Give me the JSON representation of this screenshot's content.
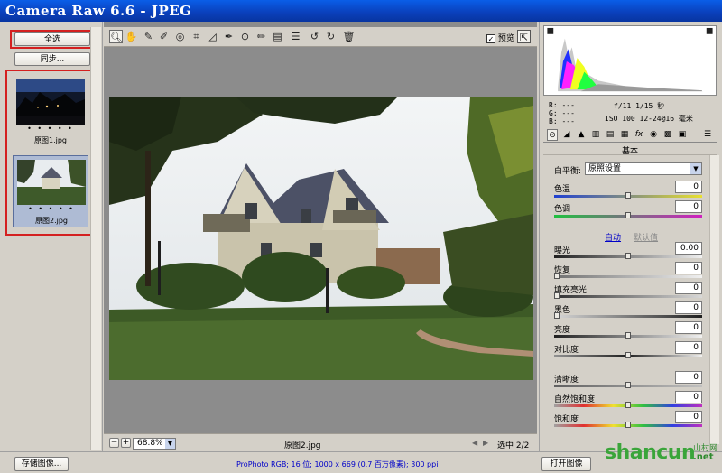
{
  "window": {
    "title": "Camera Raw 6.6 -  JPEG"
  },
  "left": {
    "select_all": "全选",
    "sync": "同步...",
    "thumbnails": [
      {
        "dots": "• • • • •",
        "filename": "原图1.jpg",
        "selected": false
      },
      {
        "dots": "• • • • •",
        "filename": "原图2.jpg",
        "selected": true
      }
    ]
  },
  "toolbar": {
    "tools": [
      "zoom-icon",
      "hand-icon",
      "white-balance-icon",
      "color-sampler-icon",
      "target-adjust-icon",
      "crop-icon",
      "straighten-icon",
      "spot-removal-icon",
      "red-eye-icon",
      "adjustment-brush-icon",
      "graduated-filter-icon",
      "preferences-icon",
      "rotate-left-icon",
      "rotate-right-icon",
      "trash-icon"
    ],
    "preview_label": "预览",
    "preview_checked": "✓"
  },
  "status": {
    "zoom": "68.8%",
    "filename": "原图2.jpg",
    "selection": "选中 2/2"
  },
  "histogram": {
    "r": "R:  ---",
    "g": "G:  ---",
    "b": "B:  ---",
    "aperture_shutter": "f/11   1/15 秒",
    "iso_lens": "ISO 100   12-24@16 毫米"
  },
  "panel": {
    "title": "基本",
    "white_balance_label": "白平衡:",
    "white_balance_value": "原照设置",
    "auto": "自动",
    "default": "默认值",
    "sliders": [
      {
        "label": "色温",
        "value": "0",
        "pos": 50
      },
      {
        "label": "色调",
        "value": "0",
        "pos": 50
      },
      {
        "label": "曝光",
        "value": "0.00",
        "pos": 50
      },
      {
        "label": "恢复",
        "value": "0",
        "pos": 0
      },
      {
        "label": "填充亮光",
        "value": "0",
        "pos": 0
      },
      {
        "label": "黑色",
        "value": "0",
        "pos": 0
      },
      {
        "label": "亮度",
        "value": "0",
        "pos": 50
      },
      {
        "label": "对比度",
        "value": "0",
        "pos": 50
      },
      {
        "label": "清晰度",
        "value": "0",
        "pos": 50
      },
      {
        "label": "自然饱和度",
        "value": "0",
        "pos": 50
      },
      {
        "label": "饱和度",
        "value": "0",
        "pos": 50
      }
    ]
  },
  "bottom": {
    "save": "存储图像...",
    "workflow": "ProPhoto RGB; 16 位; 1000 x 669 (0.7 百万像素); 300 ppi",
    "open": "打开图像",
    "watermark_main": "shancun",
    "watermark_sub": "山村网",
    "watermark_domain": ".net"
  },
  "colors": {
    "accent_red": "#d42020",
    "title_blue": "#0a4fd2"
  }
}
